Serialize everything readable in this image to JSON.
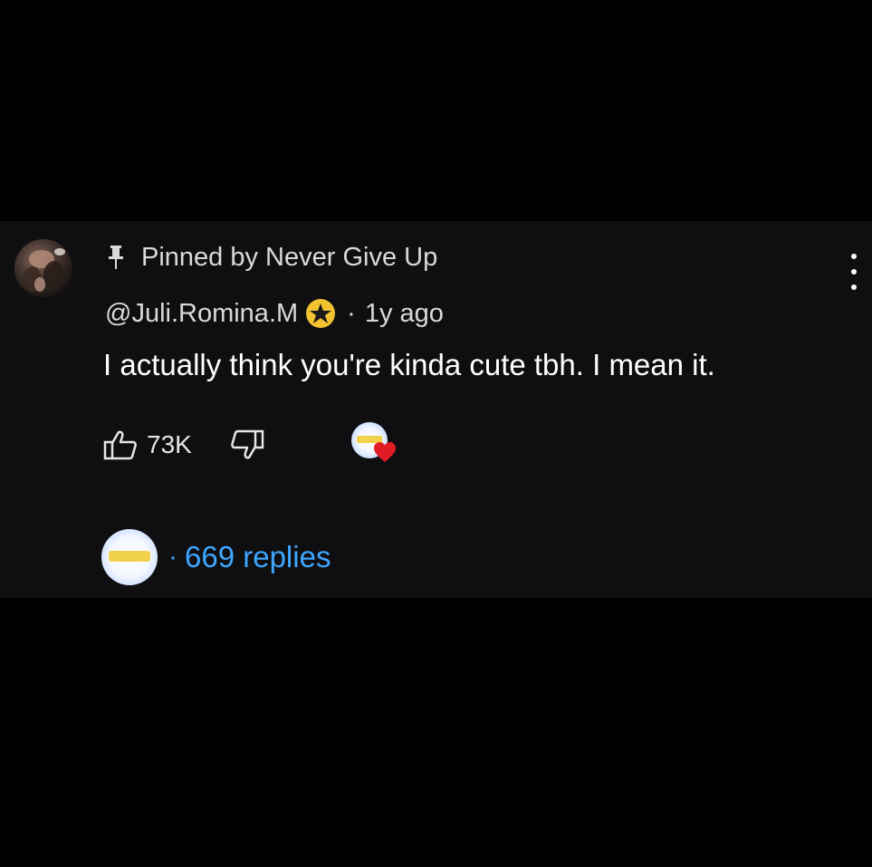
{
  "pinned": {
    "icon": "pin-icon",
    "label": "Pinned by Never Give Up"
  },
  "comment": {
    "author": "@Juli.Romina.M",
    "badge_icon": "star-badge-icon",
    "separator": "·",
    "time": "1y ago",
    "text": "I actually think you're kinda cute tbh. I mean it."
  },
  "actions": {
    "like_icon": "thumbs-up-icon",
    "like_count": "73K",
    "dislike_icon": "thumbs-down-icon",
    "creator_heart_icon": "creator-heart-icon"
  },
  "replies": {
    "separator": "·",
    "label": "669 replies"
  },
  "menu": {
    "icon": "more-vert-icon"
  },
  "colors": {
    "background": "#000000",
    "card": "#0f0f11",
    "text": "#ffffff",
    "secondary_text": "#d9d9d9",
    "link": "#3ea6ff",
    "badge": "#f2c230",
    "heart": "#e01b24"
  }
}
